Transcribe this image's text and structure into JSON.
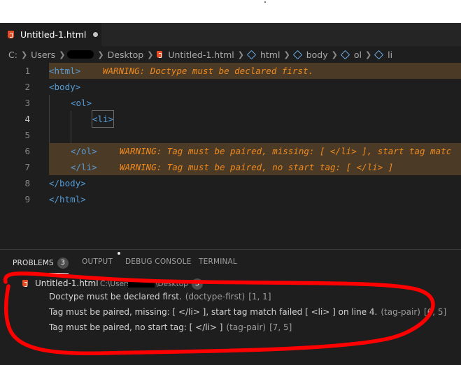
{
  "tab": {
    "label": "Untitled-1.html"
  },
  "breadcrumb": {
    "items": [
      "C:",
      "Users",
      "Desktop",
      "Untitled-1.html",
      "html",
      "body",
      "ol",
      "li"
    ]
  },
  "editor": {
    "lines": [
      {
        "num": "1",
        "code": "<html>",
        "warning": "WARNING: Doctype must be declared first."
      },
      {
        "num": "2",
        "code": "<body>",
        "warning": ""
      },
      {
        "num": "3",
        "code": "<ol>",
        "warning": ""
      },
      {
        "num": "4",
        "code": "<li>",
        "warning": ""
      },
      {
        "num": "5",
        "code": "",
        "warning": ""
      },
      {
        "num": "6",
        "code": "</ol>",
        "warning": "WARNING: Tag must be paired, missing: [ </li> ], start tag matc"
      },
      {
        "num": "7",
        "code": "</li>",
        "warning": "WARNING: Tag must be paired, no start tag: [ </li> ]"
      },
      {
        "num": "8",
        "code": "</body>",
        "warning": ""
      },
      {
        "num": "9",
        "code": "</html>",
        "warning": ""
      }
    ]
  },
  "panel": {
    "tabs": {
      "problems": "PROBLEMS",
      "problems_count": "3",
      "output": "OUTPUT",
      "debug": "DEBUG CONSOLE",
      "terminal": "TERMINAL"
    },
    "file": {
      "name": "Untitled-1.html",
      "path_start": "C:\\Users\\",
      "path_end": "\\Desktop",
      "count": "3"
    },
    "problems": [
      {
        "message": "Doctype must be declared first.",
        "source": "(doctype-first)",
        "position": "[1, 1]"
      },
      {
        "message": "Tag must be paired, missing: [ </li> ], start tag match failed [ <li> ] on line 4.",
        "source": "(tag-pair)",
        "position": "[6, 5]"
      },
      {
        "message": "Tag must be paired, no start tag: [ </li> ]",
        "source": "(tag-pair)",
        "position": "[7, 5]"
      }
    ]
  },
  "colors": {
    "editor_bg": "#1e1e1e",
    "warning_text": "#f08a1e",
    "warning_highlight": "#4b3a26",
    "tag_blue": "#569cd6",
    "annotation_red": "#ff0000"
  }
}
